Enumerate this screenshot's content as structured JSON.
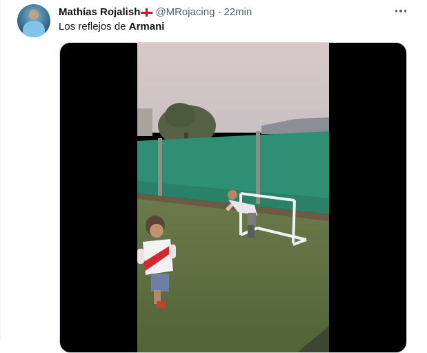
{
  "tweet": {
    "author_name": "Mathías Rojalish",
    "flag_icon": "england-flag-icon",
    "handle": "@MRojacing",
    "separator": "·",
    "time": "22min",
    "text_prefix": "Los reflejos de ",
    "text_bold": "Armani"
  },
  "colors": {
    "text_primary": "#0f1419",
    "text_secondary": "#536471",
    "media_background": "#000000"
  }
}
